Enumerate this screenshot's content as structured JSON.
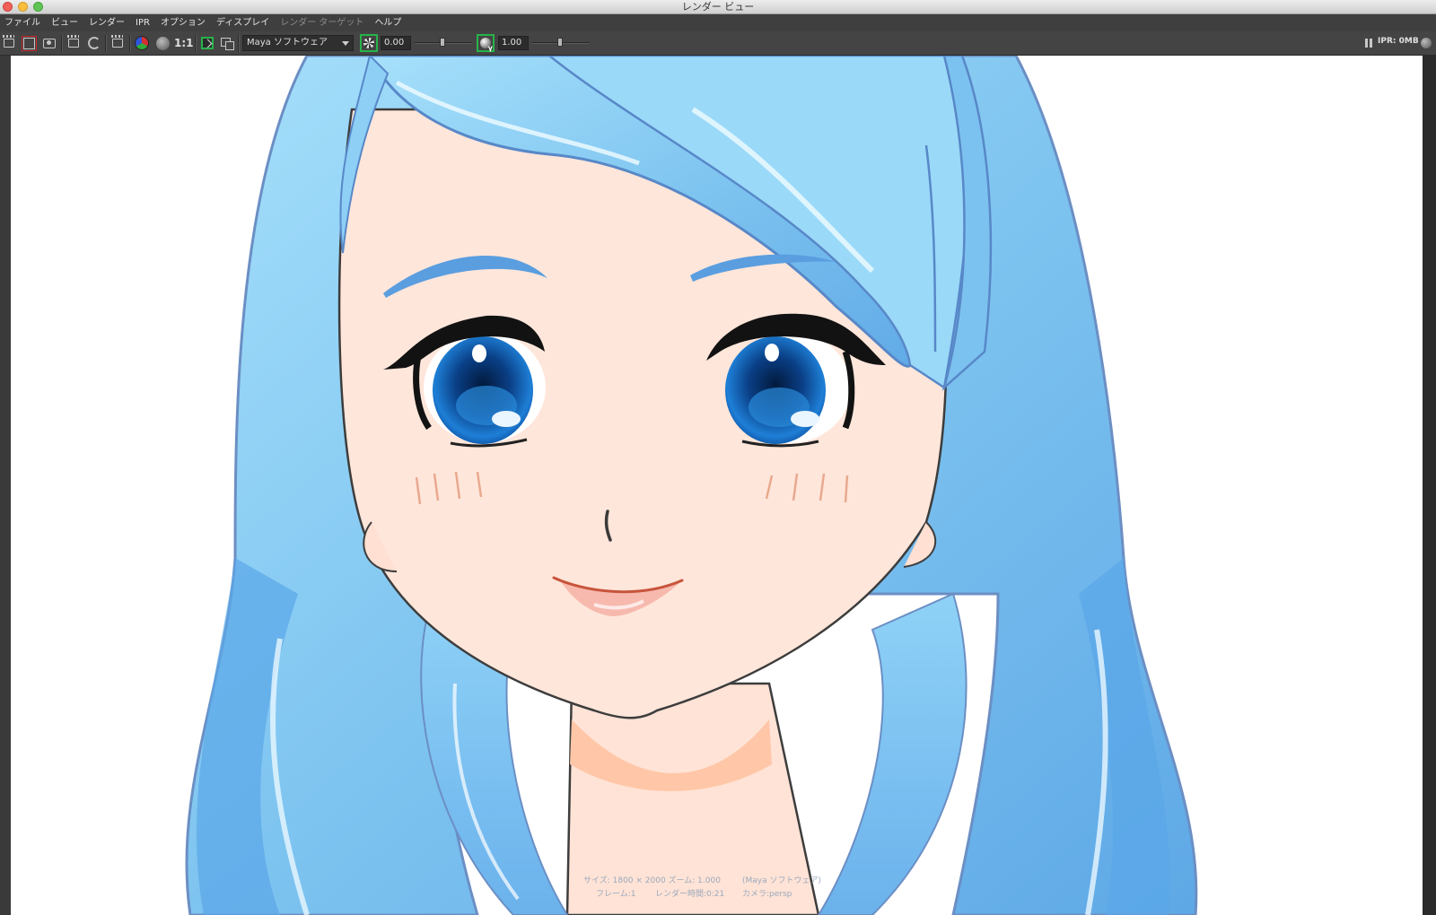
{
  "window": {
    "title": "レンダー ビュー"
  },
  "menu": [
    "ファイル",
    "ビュー",
    "レンダー",
    "IPR",
    "オプション",
    "ディスプレイ",
    "レンダー ターゲット",
    "ヘルプ"
  ],
  "toolbar": {
    "renderer": "Maya ソフトウェア",
    "exposure_value": "0.00",
    "gamma_value": "1.00",
    "ratio_label": "1:1",
    "ipr_memory": "IPR: 0MB"
  },
  "hud": {
    "line1_left": "サイズ: 1800 × 2000  ズーム: 1.000",
    "line1_right": "(Maya ソフトウェア)",
    "line2_left": "フレーム:1",
    "line2_mid": "レンダー時間:0:21",
    "line2_right": "カメラ:persp"
  },
  "colors": {
    "hair": "#7ec4f0",
    "hair_dark": "#5a9ee0",
    "skin": "#ffe6da",
    "eye": "#0e4f9a",
    "accent_green": "#27b34a"
  }
}
